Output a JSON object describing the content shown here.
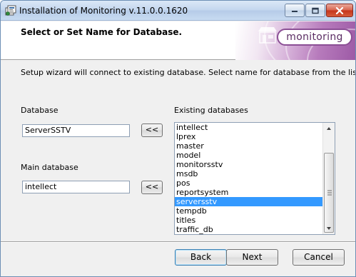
{
  "window": {
    "title": "Installation of Monitoring v.11.0.0.1620"
  },
  "banner": {
    "heading": "Select or Set Name for Database.",
    "brand": "monitoring"
  },
  "description": "Setup wizard will connect to existing database. Select name for database from the list.",
  "fields": {
    "database_label": "Database",
    "database_value": "ServerSSTV",
    "main_database_label": "Main database",
    "main_database_value": "intellect",
    "copy_button_label": "<<"
  },
  "existing": {
    "label": "Existing databases",
    "items": [
      "intellect",
      "lprex",
      "master",
      "model",
      "monitorsstv",
      "msdb",
      "pos",
      "reportsystem",
      "serversstv",
      "tempdb",
      "titles",
      "traffic_db"
    ],
    "selected": "serversstv"
  },
  "buttons": {
    "back": "Back",
    "next": "Next",
    "cancel": "Cancel"
  }
}
